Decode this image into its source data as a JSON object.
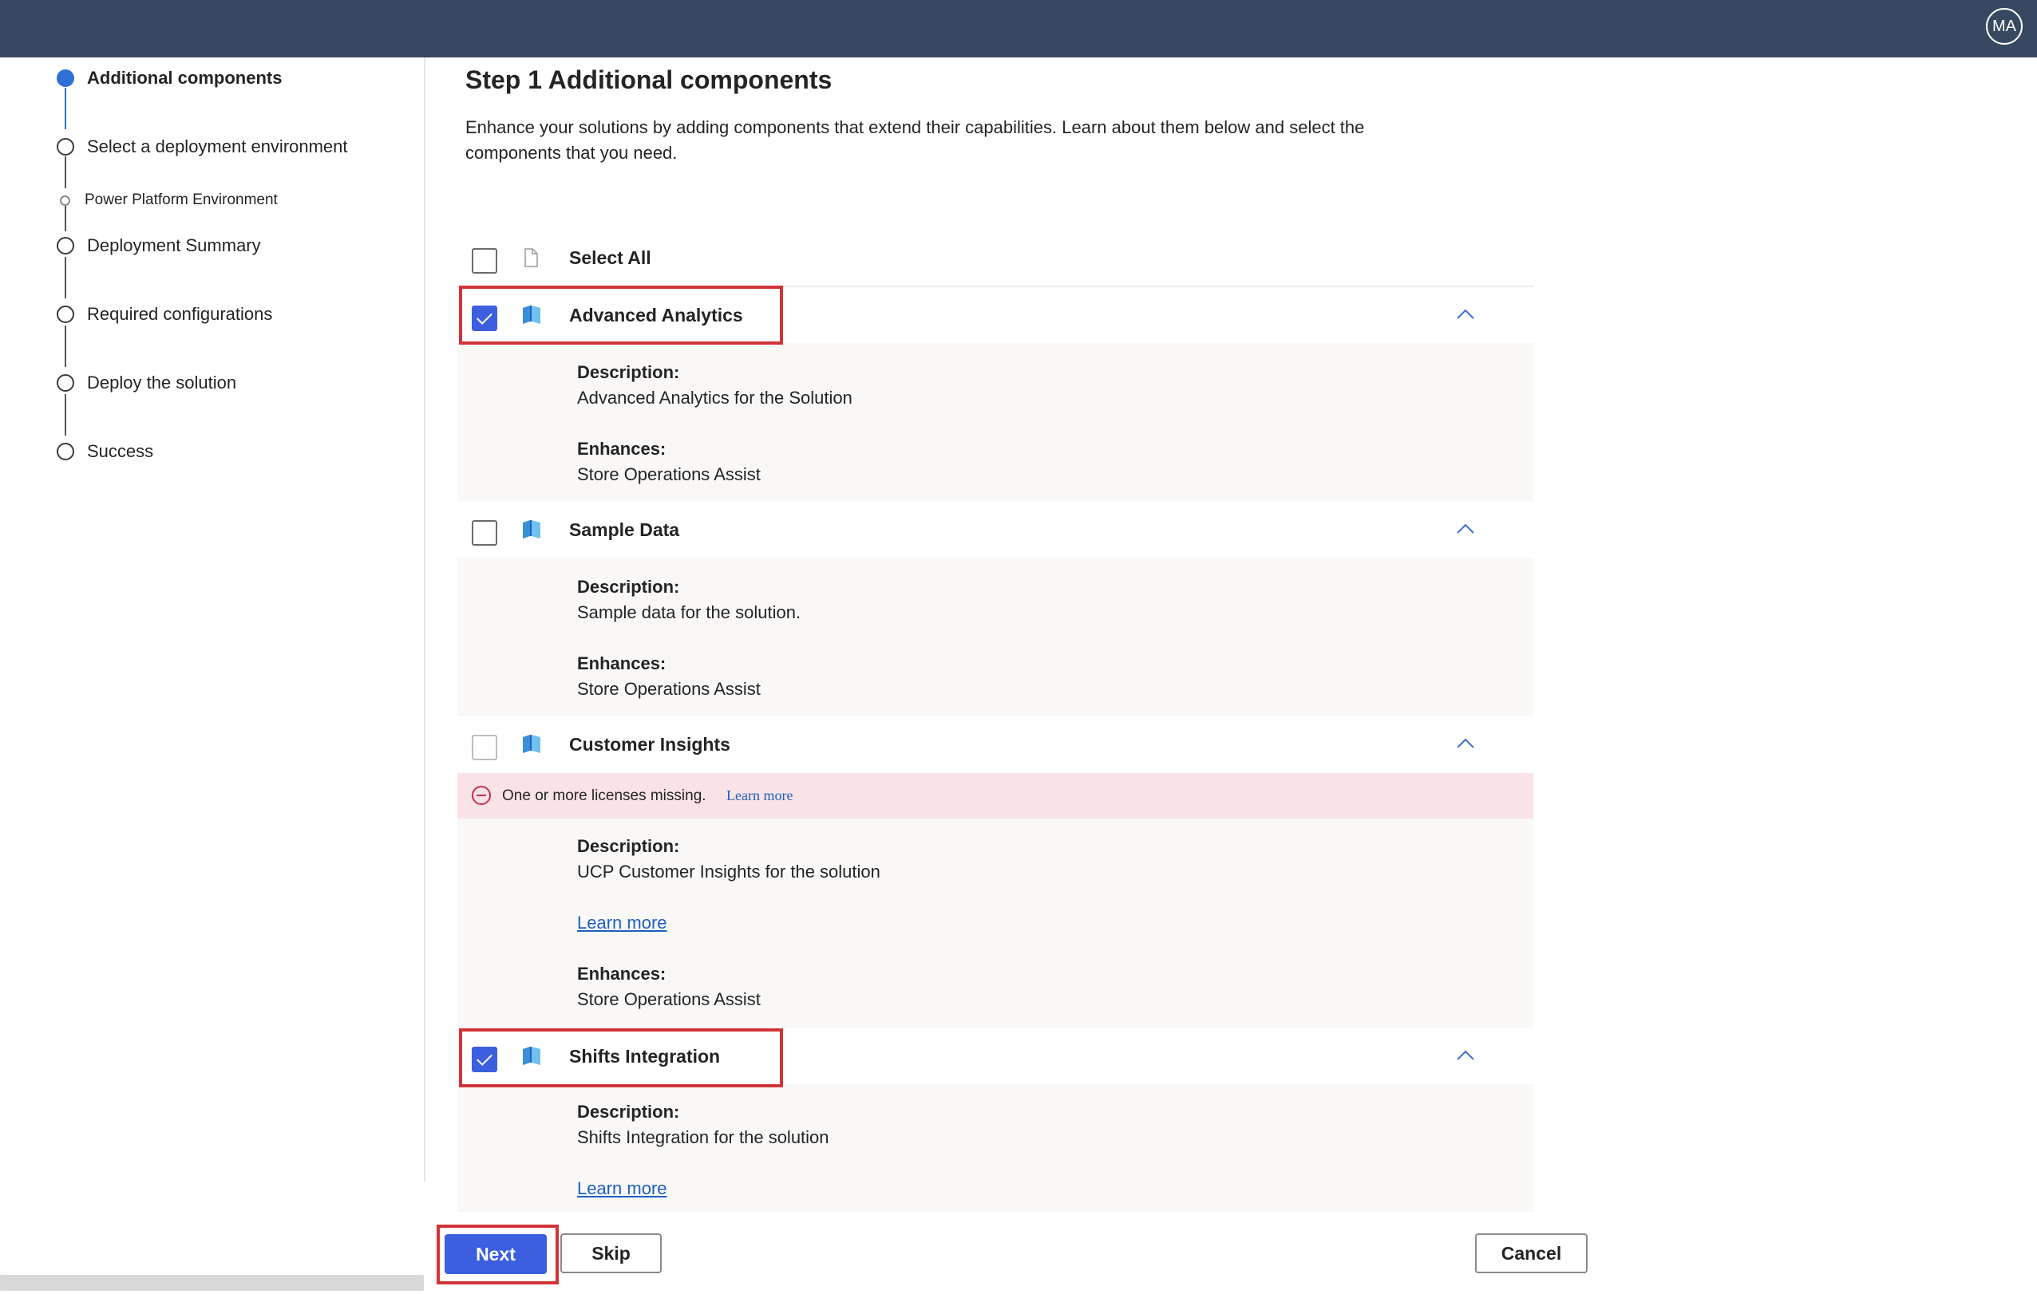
{
  "header": {
    "avatar_initials": "MA"
  },
  "sidebar": {
    "steps": [
      {
        "label": "Additional components",
        "state": "active"
      },
      {
        "label": "Select a deployment environment",
        "state": "pending"
      },
      {
        "label": "Power Platform Environment",
        "state": "substep"
      },
      {
        "label": "Deployment Summary",
        "state": "pending"
      },
      {
        "label": "Required configurations",
        "state": "pending"
      },
      {
        "label": "Deploy the solution",
        "state": "pending"
      },
      {
        "label": "Success",
        "state": "pending"
      }
    ]
  },
  "main": {
    "title": "Step 1 Additional components",
    "intro": "Enhance your solutions by adding components that extend their capabilities. Learn about them below and select the components that you need.",
    "select_all": {
      "label": "Select All",
      "checked": false
    },
    "components": [
      {
        "name": "Advanced Analytics",
        "checked": true,
        "description_label": "Description:",
        "description": "Advanced Analytics for the Solution",
        "enhances_label": "Enhances:",
        "enhances": "Store Operations Assist"
      },
      {
        "name": "Sample Data",
        "checked": false,
        "description_label": "Description:",
        "description": "Sample data for the solution.",
        "enhances_label": "Enhances:",
        "enhances": "Store Operations Assist"
      },
      {
        "name": "Customer Insights",
        "checked": false,
        "disabled": true,
        "alert": "One or more licenses missing.",
        "alert_link": "Learn more",
        "description_label": "Description:",
        "description": "UCP Customer Insights for the solution",
        "learn_more": "Learn more",
        "enhances_label": "Enhances:",
        "enhances": "Store Operations Assist"
      },
      {
        "name": "Shifts Integration",
        "checked": true,
        "description_label": "Description:",
        "description": "Shifts Integration for the solution",
        "learn_more": "Learn more"
      }
    ]
  },
  "footer": {
    "next_label": "Next",
    "skip_label": "Skip",
    "cancel_label": "Cancel"
  },
  "colors": {
    "header_bg": "#374860",
    "accent": "#3b5fde",
    "highlight": "#d13438",
    "alert_bg": "#f9e3e6"
  }
}
